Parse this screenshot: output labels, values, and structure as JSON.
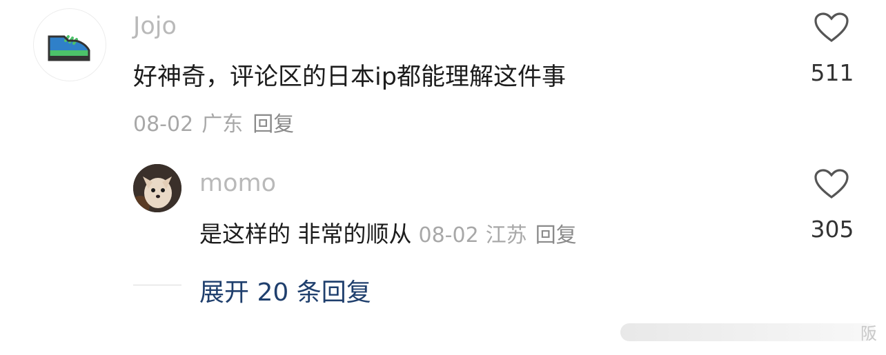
{
  "comments": [
    {
      "username": "Jojo",
      "text": "好神奇，评论区的日本ip都能理解这件事",
      "date": "08-02",
      "location": "广东",
      "reply_label": "回复",
      "likes": "511",
      "avatar_icon": "sneaker-icon"
    }
  ],
  "reply": {
    "username": "momo",
    "text": "是这样的 非常的顺从",
    "date": "08-02",
    "location": "江苏",
    "reply_label": "回复",
    "likes": "305",
    "avatar_icon": "dog-photo"
  },
  "expand_label": "展开 20 条回复",
  "watermark_text": "阪",
  "colors": {
    "username": "#b9b9b9",
    "meta": "#a8a8a8",
    "expand_link": "#1f3f6d",
    "sneaker_blue": "#2f80c9",
    "sneaker_green": "#4cc26a"
  }
}
